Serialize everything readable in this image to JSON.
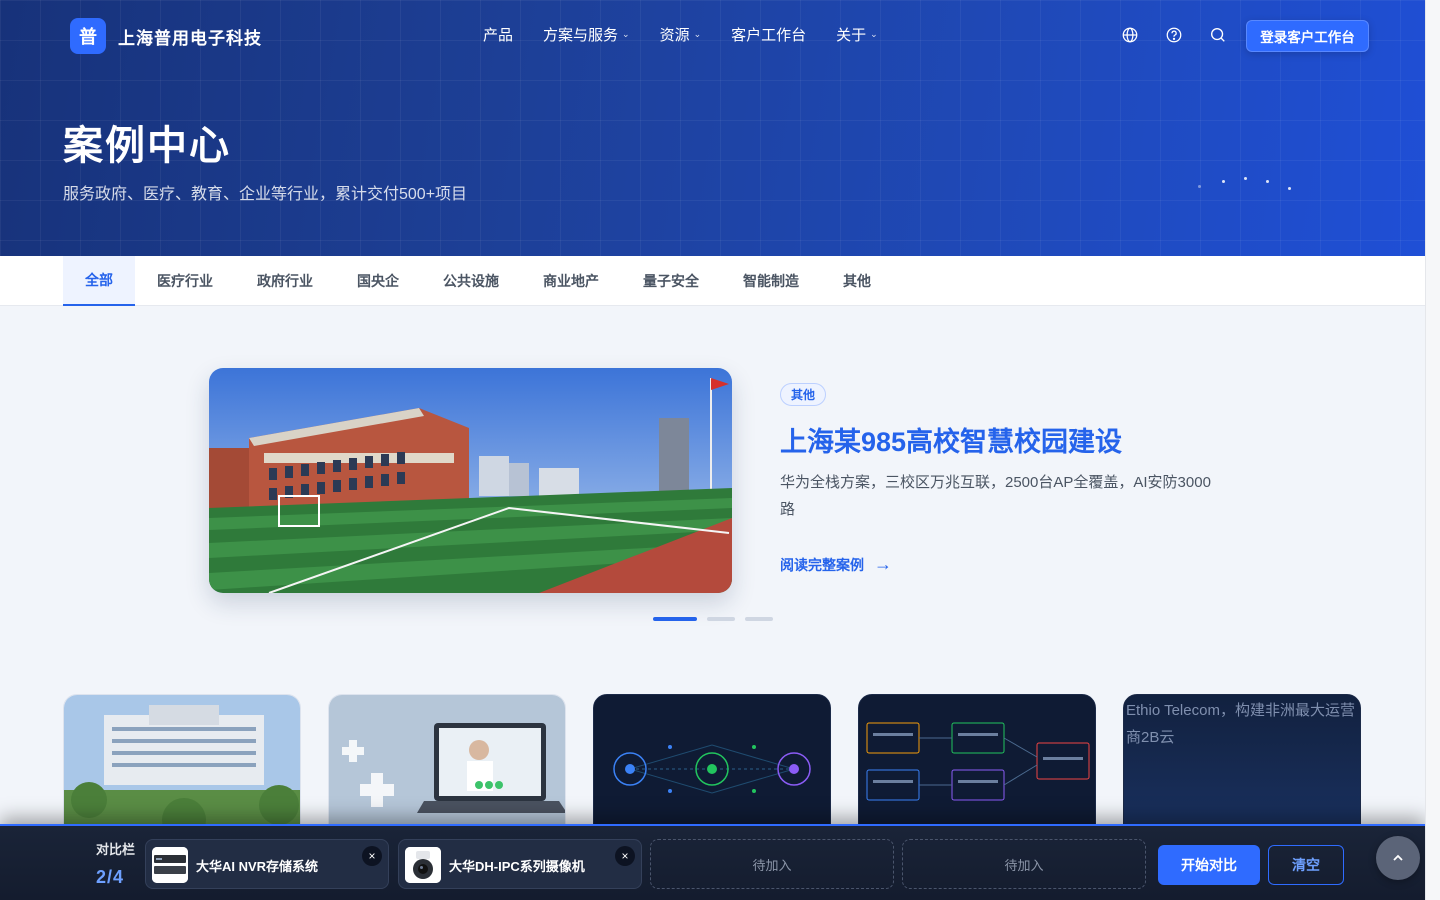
{
  "brand": {
    "logo_char": "普",
    "name": "上海普用电子科技"
  },
  "nav": {
    "items": [
      {
        "label": "产品",
        "dropdown": false
      },
      {
        "label": "方案与服务",
        "dropdown": true
      },
      {
        "label": "资源",
        "dropdown": true
      },
      {
        "label": "客户工作台",
        "dropdown": false
      },
      {
        "label": "关于",
        "dropdown": true
      }
    ],
    "icons": [
      "globe-icon",
      "help-icon",
      "search-icon"
    ],
    "login_label": "登录客户工作台"
  },
  "hero": {
    "title": "案例中心",
    "subtitle": "服务政府、医疗、教育、企业等行业，累计交付500+项目"
  },
  "tabs": [
    "全部",
    "医疗行业",
    "政府行业",
    "国央企",
    "公共设施",
    "商业地产",
    "量子安全",
    "智能制造",
    "其他"
  ],
  "active_tab": "全部",
  "featured": {
    "tag": "其他",
    "title": "上海某985高校智慧校园建设",
    "description": "华为全栈方案，三校区万兆互联，2500台AP全覆盖，AI安防3000路",
    "link_label": "阅读完整案例",
    "link_arrow": "→",
    "slides": 3,
    "active_slide": 1
  },
  "cards": {
    "broken_alt": "Ethio Telecom，构建非洲最大运营商2B云"
  },
  "compare": {
    "label": "对比栏",
    "count": "2/4",
    "items": [
      {
        "name": "大华AI NVR存储系统"
      },
      {
        "name": "大华DH-IPC系列摄像机"
      }
    ],
    "empty_label": "待加入",
    "close_glyph": "×",
    "start_label": "开始对比",
    "clear_label": "清空"
  },
  "colors": {
    "accent": "#2f6bff",
    "hero_start": "#17327a",
    "hero_end": "#1f4fd6",
    "compare_bg": "#1a2438"
  }
}
